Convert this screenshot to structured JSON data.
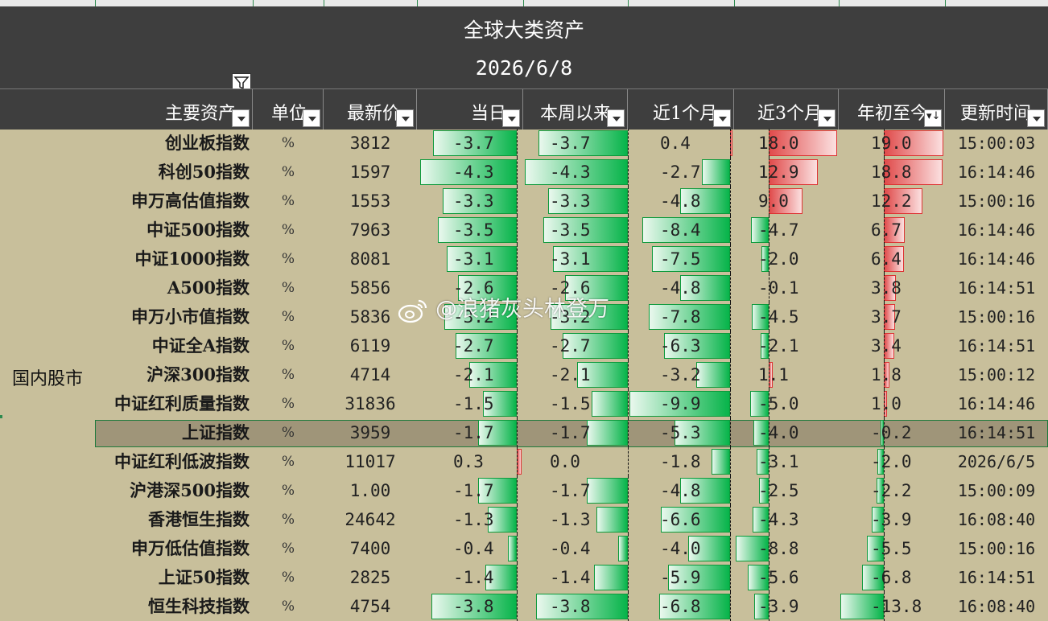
{
  "sheet": {
    "title": "全球大类资产",
    "date": "2026/6/8",
    "group_label": "国内股市"
  },
  "headers": [
    {
      "label": "主要资产"
    },
    {
      "label": "单位"
    },
    {
      "label": "最新价"
    },
    {
      "label": "当日"
    },
    {
      "label": "本周以来"
    },
    {
      "label": "近1个月"
    },
    {
      "label": "近3个月"
    },
    {
      "label": "年初至今",
      "sorted": "descending"
    },
    {
      "label": "更新时间"
    }
  ],
  "rows": [
    {
      "name": "创业板指数",
      "unit": "%",
      "price": "3812",
      "d": "-3.7",
      "w": "-3.7",
      "m1": "0.4",
      "m3": "18.0",
      "ytd": "19.0",
      "time": "15:00:03"
    },
    {
      "name": "科创50指数",
      "unit": "%",
      "price": "1597",
      "d": "-4.3",
      "w": "-4.3",
      "m1": "-2.7",
      "m3": "12.9",
      "ytd": "18.8",
      "time": "16:14:46"
    },
    {
      "name": "申万高估值指数",
      "unit": "%",
      "price": "1553",
      "d": "-3.3",
      "w": "-3.3",
      "m1": "-4.8",
      "m3": "9.0",
      "ytd": "12.2",
      "time": "15:00:16"
    },
    {
      "name": "中证500指数",
      "unit": "%",
      "price": "7963",
      "d": "-3.5",
      "w": "-3.5",
      "m1": "-8.4",
      "m3": "-4.7",
      "ytd": "6.7",
      "time": "16:14:46"
    },
    {
      "name": "中证1000指数",
      "unit": "%",
      "price": "8081",
      "d": "-3.1",
      "w": "-3.1",
      "m1": "-7.5",
      "m3": "-2.0",
      "ytd": "6.4",
      "time": "16:14:46"
    },
    {
      "name": "A500指数",
      "unit": "%",
      "price": "5856",
      "d": "-2.6",
      "w": "-2.6",
      "m1": "-4.8",
      "m3": "-0.1",
      "ytd": "3.8",
      "time": "16:14:51"
    },
    {
      "name": "申万小市值指数",
      "unit": "%",
      "price": "5836",
      "d": "-3.2",
      "w": "-3.2",
      "m1": "-7.8",
      "m3": "-4.5",
      "ytd": "3.7",
      "time": "15:00:16"
    },
    {
      "name": "中证全A指数",
      "unit": "%",
      "price": "6119",
      "d": "-2.7",
      "w": "-2.7",
      "m1": "-6.3",
      "m3": "-2.1",
      "ytd": "3.4",
      "time": "16:14:51"
    },
    {
      "name": "沪深300指数",
      "unit": "%",
      "price": "4714",
      "d": "-2.1",
      "w": "-2.1",
      "m1": "-3.2",
      "m3": "1.1",
      "ytd": "1.8",
      "time": "15:00:12"
    },
    {
      "name": "中证红利质量指数",
      "unit": "%",
      "price": "31836",
      "d": "-1.5",
      "w": "-1.5",
      "m1": "-9.9",
      "m3": "-5.0",
      "ytd": "1.0",
      "time": "16:14:46"
    },
    {
      "name": "上证指数",
      "unit": "%",
      "price": "3959",
      "d": "-1.7",
      "w": "-1.7",
      "m1": "-5.3",
      "m3": "-4.0",
      "ytd": "-0.2",
      "time": "16:14:51",
      "selected": true
    },
    {
      "name": "中证红利低波指数",
      "unit": "%",
      "price": "11017",
      "d": "0.3",
      "w": "0.0",
      "m1": "-1.8",
      "m3": "-3.1",
      "ytd": "-2.0",
      "time": "2026/6/5"
    },
    {
      "name": "沪港深500指数",
      "unit": "%",
      "price": "1.00",
      "d": "-1.7",
      "w": "-1.7",
      "m1": "-4.8",
      "m3": "-2.5",
      "ytd": "-2.2",
      "time": "15:00:09"
    },
    {
      "name": "香港恒生指数",
      "unit": "%",
      "price": "24642",
      "d": "-1.3",
      "w": "-1.3",
      "m1": "-6.6",
      "m3": "-4.3",
      "ytd": "-3.9",
      "time": "16:08:40"
    },
    {
      "name": "申万低估值指数",
      "unit": "%",
      "price": "7400",
      "d": "-0.4",
      "w": "-0.4",
      "m1": "-4.0",
      "m3": "-8.8",
      "ytd": "-5.5",
      "time": "15:00:16"
    },
    {
      "name": "上证50指数",
      "unit": "%",
      "price": "2825",
      "d": "-1.4",
      "w": "-1.4",
      "m1": "-5.9",
      "m3": "-5.6",
      "ytd": "-6.8",
      "time": "16:14:51"
    },
    {
      "name": "恒生科技指数",
      "unit": "%",
      "price": "4754",
      "d": "-3.8",
      "w": "-3.8",
      "m1": "-6.8",
      "m3": "-3.9",
      "ytd": "-13.8",
      "time": "16:08:40"
    }
  ],
  "watermark": "@浪猪灰头林登万",
  "colors": {
    "neg_bar": "#07b44a",
    "pos_bar": "#e04b4b",
    "header_bg": "#3e3e3e",
    "body_bg": "#c8bf9b"
  }
}
